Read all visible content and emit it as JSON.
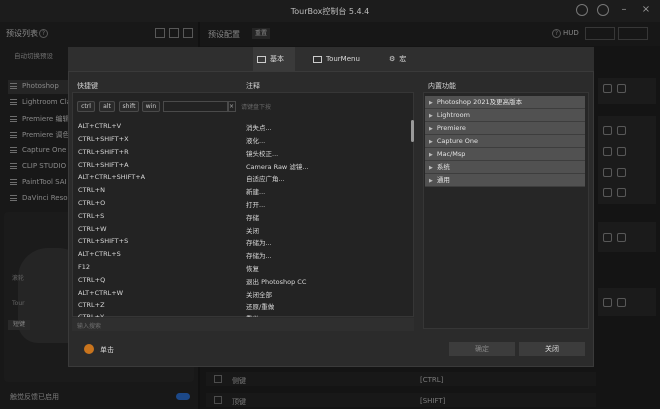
{
  "app": {
    "title": "TourBox控制台 5.4.4"
  },
  "left": {
    "header": "预设列表",
    "auto_switch": "自动切换预设",
    "presets": [
      "Photoshop",
      "Lightroom Cla",
      "Premiere 编辑",
      "Premiere 调色",
      "Capture One",
      "CLIP STUDIO",
      "PaintTool SAI",
      "DaVinci Reso"
    ],
    "device_labels": [
      "滚轮",
      "Tour",
      "短键"
    ],
    "footer_label": "触觉反馈已启用"
  },
  "right": {
    "header": "预设配置",
    "reset": "重置",
    "hud": "HUD",
    "rows": [
      {
        "label": "侧键",
        "value": "[CTRL]"
      },
      {
        "label": "顶键",
        "value": "[SHIFT]"
      }
    ]
  },
  "dialog": {
    "tabs": [
      "基本",
      "TourMenu",
      "宏"
    ],
    "col_shortcut": "快捷键",
    "col_note": "注释",
    "col_builtin": "内置功能",
    "modifiers": [
      "ctrl",
      "alt",
      "shift",
      "win"
    ],
    "key_hint": "请键盘下按",
    "shortcuts": [
      {
        "key": "ALT+CTRL+V",
        "note": "消失点..."
      },
      {
        "key": "CTRL+SHIFT+X",
        "note": "液化..."
      },
      {
        "key": "CTRL+SHIFT+R",
        "note": "镜头校正..."
      },
      {
        "key": "CTRL+SHIFT+A",
        "note": "Camera Raw 滤镜..."
      },
      {
        "key": "ALT+CTRL+SHIFT+A",
        "note": "自适应广角..."
      },
      {
        "key": "CTRL+N",
        "note": "新建..."
      },
      {
        "key": "CTRL+O",
        "note": "打开..."
      },
      {
        "key": "CTRL+S",
        "note": "存储"
      },
      {
        "key": "CTRL+W",
        "note": "关闭"
      },
      {
        "key": "CTRL+SHIFT+S",
        "note": "存储为..."
      },
      {
        "key": "ALT+CTRL+S",
        "note": "存储为..."
      },
      {
        "key": "F12",
        "note": "恢复"
      },
      {
        "key": "CTRL+Q",
        "note": "退出 Photoshop CC"
      },
      {
        "key": "ALT+CTRL+W",
        "note": "关闭全部"
      },
      {
        "key": "CTRL+Z",
        "note": "还原/重做"
      },
      {
        "key": "CTRL+Y",
        "note": "重做"
      }
    ],
    "search_placeholder": "输入搜索",
    "builtin": [
      "Photoshop 2021及更高版本",
      "Lightroom",
      "Premiere",
      "Capture One",
      "Mac/Msp",
      "系统",
      "通用"
    ],
    "footer_label": "单击",
    "ok": "确定",
    "close": "关闭"
  },
  "colors": {
    "accent": "#2c6fd1",
    "footer_icon": "#c9741d"
  }
}
